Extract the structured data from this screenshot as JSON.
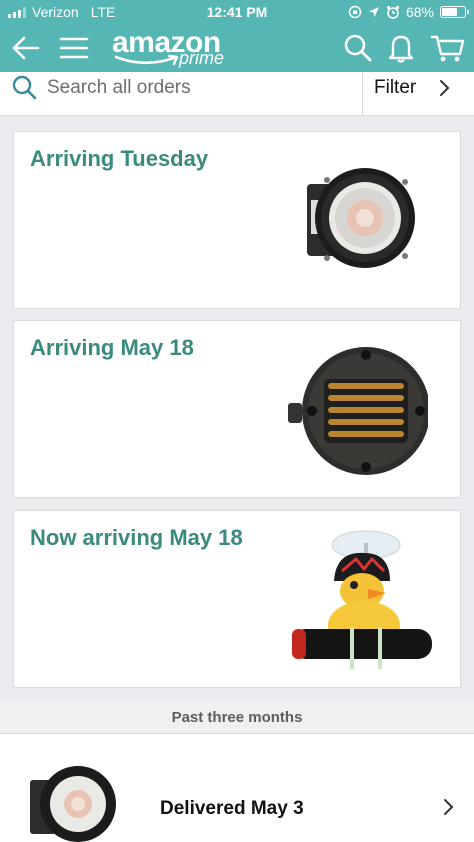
{
  "status_bar": {
    "carrier": "Verizon",
    "network": "LTE",
    "time": "12:41 PM",
    "battery_percent": "68%",
    "battery_level": 0.68
  },
  "header": {
    "logo_text": "amazon",
    "logo_subtext": "prime",
    "color": "#55b6b4",
    "icons": [
      "back-arrow-icon",
      "menu-icon",
      "search-icon",
      "bell-icon",
      "cart-icon"
    ]
  },
  "search": {
    "placeholder": "Search all orders",
    "filter_label": "Filter"
  },
  "orders": [
    {
      "status": "Arriving Tuesday",
      "item": "full-range-speaker"
    },
    {
      "status": "Arriving May 18",
      "item": "ribbon-tweeter"
    },
    {
      "status": "Now arriving May 18",
      "item": "rubber-duck-bike-light"
    }
  ],
  "past_section": {
    "label": "Past three months",
    "items": [
      {
        "status": "Delivered May 3",
        "item": "full-range-speaker"
      }
    ]
  },
  "colors": {
    "accent": "#55b6b4",
    "status_text": "#3a8a7e"
  }
}
